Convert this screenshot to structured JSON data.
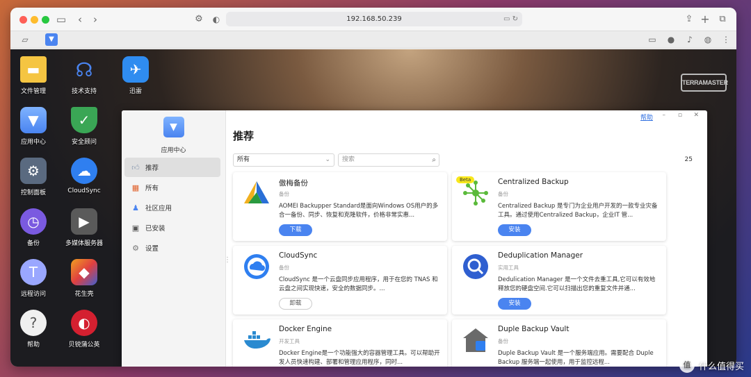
{
  "browser": {
    "url": "192.168.50.239"
  },
  "desktop": {
    "brand": "TERRAMASTER",
    "icons": [
      {
        "label": "文件管理",
        "icon": "folder-icon"
      },
      {
        "label": "技术支持",
        "icon": "headset-icon"
      },
      {
        "label": "迅雷",
        "icon": "bird-icon"
      },
      {
        "label": "应用中心",
        "icon": "shopping-bag-icon"
      },
      {
        "label": "安全顾问",
        "icon": "shield-icon"
      },
      {
        "label": "控制面板",
        "icon": "gear-icon"
      },
      {
        "label": "CloudSync",
        "icon": "cloud-sync-icon"
      },
      {
        "label": "备份",
        "icon": "backup-clock-icon"
      },
      {
        "label": "多媒体服务器",
        "icon": "media-server-icon"
      },
      {
        "label": "远程访问",
        "icon": "remote-access-icon"
      },
      {
        "label": "花生壳",
        "icon": "cube-icon"
      },
      {
        "label": "帮助",
        "icon": "help-icon"
      },
      {
        "label": "贝锐蒲公英",
        "icon": "dandelion-icon"
      }
    ]
  },
  "app_window": {
    "help_label": "帮助",
    "sidebar": {
      "title": "应用中心",
      "items": [
        {
          "label": "推荐",
          "icon": "thumbs-up-icon",
          "active": true
        },
        {
          "label": "所有",
          "icon": "grid-icon",
          "active": false
        },
        {
          "label": "社区应用",
          "icon": "community-icon",
          "active": false
        },
        {
          "label": "已安装",
          "icon": "installed-icon",
          "active": false
        },
        {
          "label": "设置",
          "icon": "settings-icon",
          "active": false
        }
      ]
    },
    "main": {
      "title": "推荐",
      "filter_value": "所有",
      "search_placeholder": "搜索",
      "count": "25"
    },
    "apps": [
      {
        "name": "傲梅备份",
        "category": "备份",
        "desc": "AOMEI Backupper Standard是面向Windows OS用户的多合一备份、同步、恢复和克隆软件，价格非常实惠...",
        "button": "下载",
        "button_style": "primary"
      },
      {
        "name": "Centralized Backup",
        "category": "备份",
        "desc": "Centralized Backup 是专门为企业用户开发的一款专业灾备工具。通过使用Centralized Backup，企业IT 管...",
        "button": "安装",
        "button_style": "primary",
        "badge": "Beta"
      },
      {
        "name": "CloudSync",
        "category": "备份",
        "desc": "CloudSync 是一个云盘同步应用程序，用于在您的 TNAS 和云盘之间实现快速，安全的数据同步。...",
        "button": "卸载",
        "button_style": "outline"
      },
      {
        "name": "Deduplication Manager",
        "category": "实用工具",
        "desc": "Dedulication Manager 是一个文件去重工具,它可以有效地释放您的硬盘空间.它可以扫描出您的重复文件并通...",
        "button": "安装",
        "button_style": "primary"
      },
      {
        "name": "Docker Engine",
        "category": "开发工具",
        "desc": "Docker Engine是一个功能强大的容器管理工具。可以帮助开发人员快速构建、部署和管理应用程序，同时...",
        "button": "",
        "button_style": "none"
      },
      {
        "name": "Duple Backup Vault",
        "category": "备份",
        "desc": "Duple Backup Vault 是一个服务端应用。需要配合 Duple Backup 服务端一起使用，用于监控远程...",
        "button": "",
        "button_style": "none"
      }
    ]
  },
  "watermark": "什么值得买",
  "colors": {
    "accent": "#4a84f0",
    "beta_badge": "#f8e71c"
  }
}
